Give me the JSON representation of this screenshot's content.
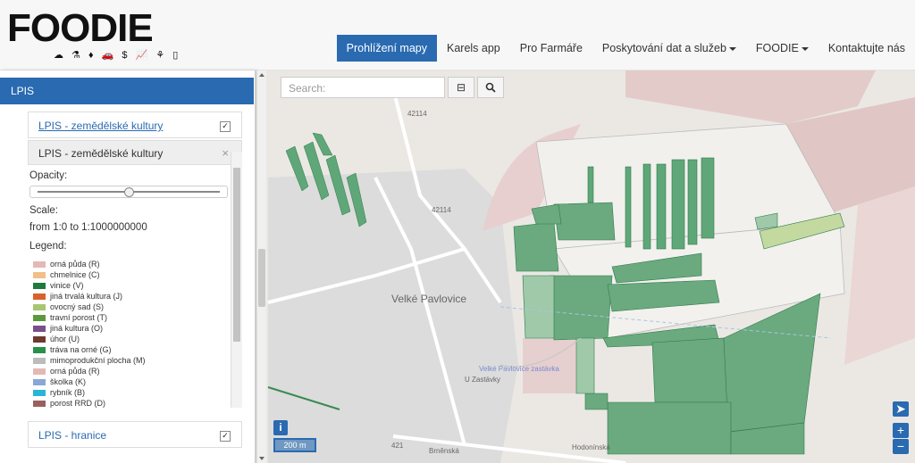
{
  "header": {
    "logo_text": "FOODIE",
    "logo_icons": "☁ ⚗ ♦ 🚗 $ 📈 ⚘ ▯",
    "nav": [
      {
        "label": "Prohlížení mapy",
        "active": true,
        "dropdown": false
      },
      {
        "label": "Karels app",
        "active": false,
        "dropdown": false
      },
      {
        "label": "Pro Farmáře",
        "active": false,
        "dropdown": false
      },
      {
        "label": "Poskytování dat a služeb",
        "active": false,
        "dropdown": true
      },
      {
        "label": "FOODIE",
        "active": false,
        "dropdown": true
      },
      {
        "label": "Kontaktujte nás",
        "active": false,
        "dropdown": false
      }
    ]
  },
  "panel": {
    "title": "LPIS",
    "layer1": {
      "name": "LPIS - zemědělské kultury",
      "checked": "✓"
    },
    "detail": {
      "title": "LPIS - zemědělské kultury",
      "close": "×",
      "opacity_label": "Opacity:",
      "opacity_value": 0.5,
      "scale_label": "Scale:",
      "scale_value": "from 1:0 to 1:1000000000",
      "legend_label": "Legend:"
    },
    "legend": [
      {
        "label": "orná půda (R)",
        "color": "#e3b9b6"
      },
      {
        "label": "chmelnice (C)",
        "color": "#f0c088"
      },
      {
        "label": "vinice (V)",
        "color": "#1f7a3c"
      },
      {
        "label": "jiná trvalá kultura (J)",
        "color": "#d9622b"
      },
      {
        "label": "ovocný sad (S)",
        "color": "#a8c670"
      },
      {
        "label": "travní porost (T)",
        "color": "#5b9a3c"
      },
      {
        "label": "jiná kultura (O)",
        "color": "#7a4f8a"
      },
      {
        "label": "úhor (U)",
        "color": "#6d3b2f"
      },
      {
        "label": "tráva na orné (G)",
        "color": "#2a8f4a"
      },
      {
        "label": "mimoprodukční plocha (M)",
        "color": "#bcbcbc"
      },
      {
        "label": "orná půda (R)",
        "color": "#e3b9b6"
      },
      {
        "label": "školka (K)",
        "color": "#8aa7d6"
      },
      {
        "label": "rybník (B)",
        "color": "#29b6d6"
      },
      {
        "label": "porost RRD (D)",
        "color": "#9a6060"
      }
    ],
    "layer2": {
      "name": "LPIS - hranice",
      "checked": "✓"
    }
  },
  "map": {
    "search_placeholder": "Search:",
    "scale_text": "200 m",
    "zoom_in": "+",
    "zoom_out": "−",
    "info": "i",
    "labels": {
      "town": "Velké Pavlovice",
      "road1": "42114",
      "road2": "42114",
      "station": "Velké Pavlovice zastávka",
      "street1": "Brněnská",
      "street2": "Hodonínská",
      "road3": "421",
      "street3": "U Zastávky"
    }
  }
}
